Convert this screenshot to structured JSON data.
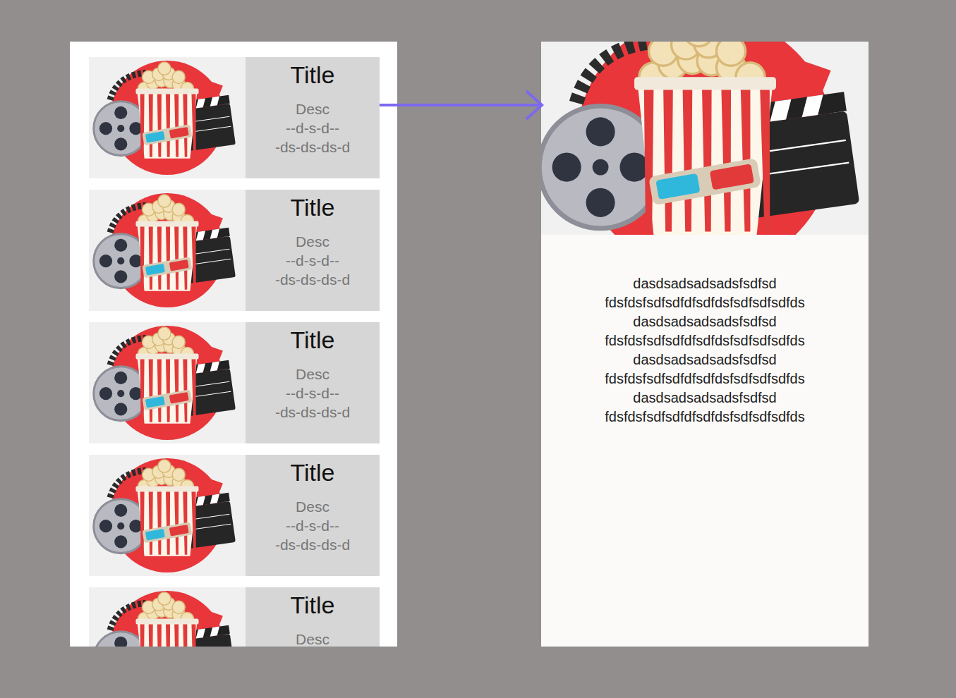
{
  "list": {
    "cards": [
      {
        "title": "Title",
        "desc": [
          "Desc",
          "--d-s-d--",
          "-ds-ds-ds-d"
        ]
      },
      {
        "title": "Title",
        "desc": [
          "Desc",
          "--d-s-d--",
          "-ds-ds-ds-d"
        ]
      },
      {
        "title": "Title",
        "desc": [
          "Desc",
          "--d-s-d--",
          "-ds-ds-ds-d"
        ]
      },
      {
        "title": "Title",
        "desc": [
          "Desc",
          "--d-s-d--",
          "-ds-ds-ds-d"
        ]
      },
      {
        "title": "Title",
        "desc": [
          "Desc"
        ]
      }
    ]
  },
  "detail": {
    "lines": [
      "dasdsadsadsadsfsdfsd",
      "fdsfdsfsdfsdfdfsdfdsfsdfsdfsdfds",
      "dasdsadsadsadsfsdfsd",
      "fdsfdsfsdfsdfdfsdfdsfsdfsdfsdfds",
      "dasdsadsadsadsfsdfsd",
      "fdsfdsfsdfsdfdfsdfdsfsdfsdfsdfds",
      "dasdsadsadsadsfsdfsd",
      "fdsfdsfsdfsdfdfsdfdsfsdfsdfsdfds"
    ]
  }
}
